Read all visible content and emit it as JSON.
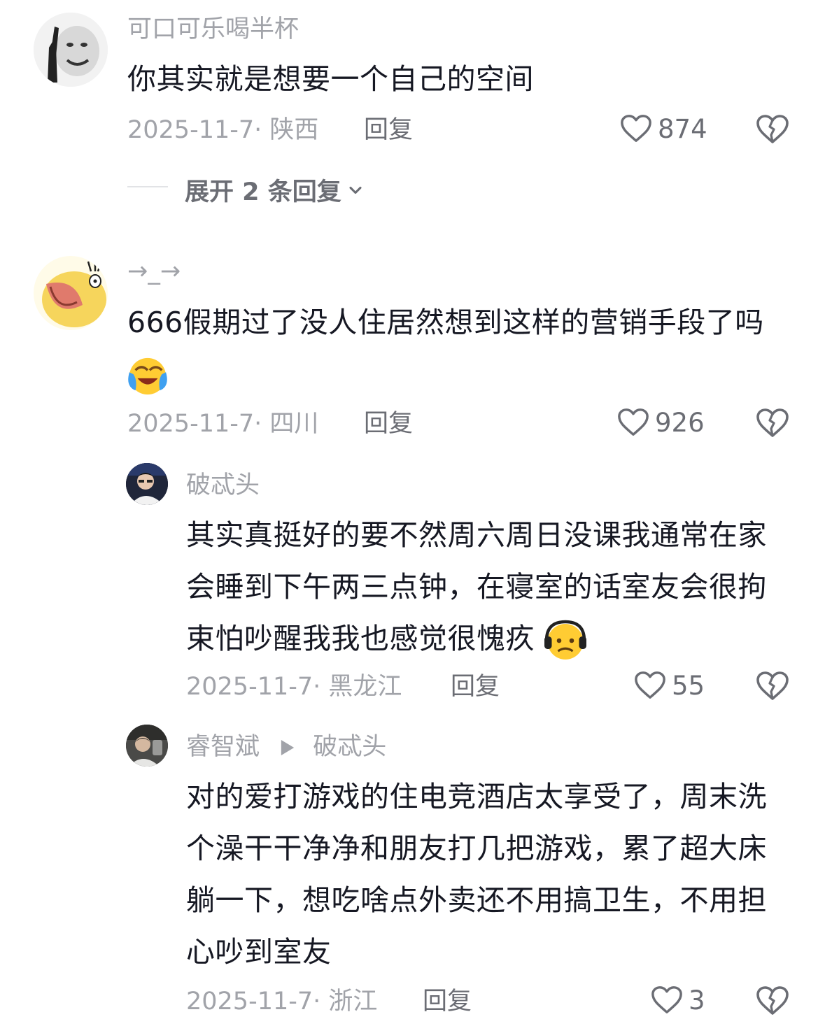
{
  "comments": [
    {
      "username": "可口可乐喝半杯",
      "text": "你其实就是想要一个自己的空间",
      "date": "2025-11-7",
      "region": "陕西",
      "reply_label": "回复",
      "likes": "874",
      "expand_label": "展开 2 条回复"
    },
    {
      "username": "→_→",
      "text": "666假期过了没人住居然想到这样的营销手段了吗",
      "date": "2025-11-7",
      "region": "四川",
      "reply_label": "回复",
      "likes": "926"
    }
  ],
  "replies": [
    {
      "username": "破忒头",
      "text": "其实真挺好的要不然周六周日没课我通常在家会睡到下午两三点钟，在寝室的话室友会很拘束怕吵醒我我也感觉很愧疚",
      "date": "2025-11-7",
      "region": "黑龙江",
      "reply_label": "回复",
      "likes": "55"
    },
    {
      "username": "睿智斌",
      "reply_to": "破忒头",
      "text": "对的爱打游戏的住电竞酒店太享受了，周末洗个澡干干净净和朋友打几把游戏，累了超大床躺一下，想吃啥点外卖还不用搞卫生，不用担心吵到室友",
      "date": "2025-11-7",
      "region": "浙江",
      "reply_label": "回复",
      "likes": "3"
    }
  ],
  "meta_separator": "·"
}
